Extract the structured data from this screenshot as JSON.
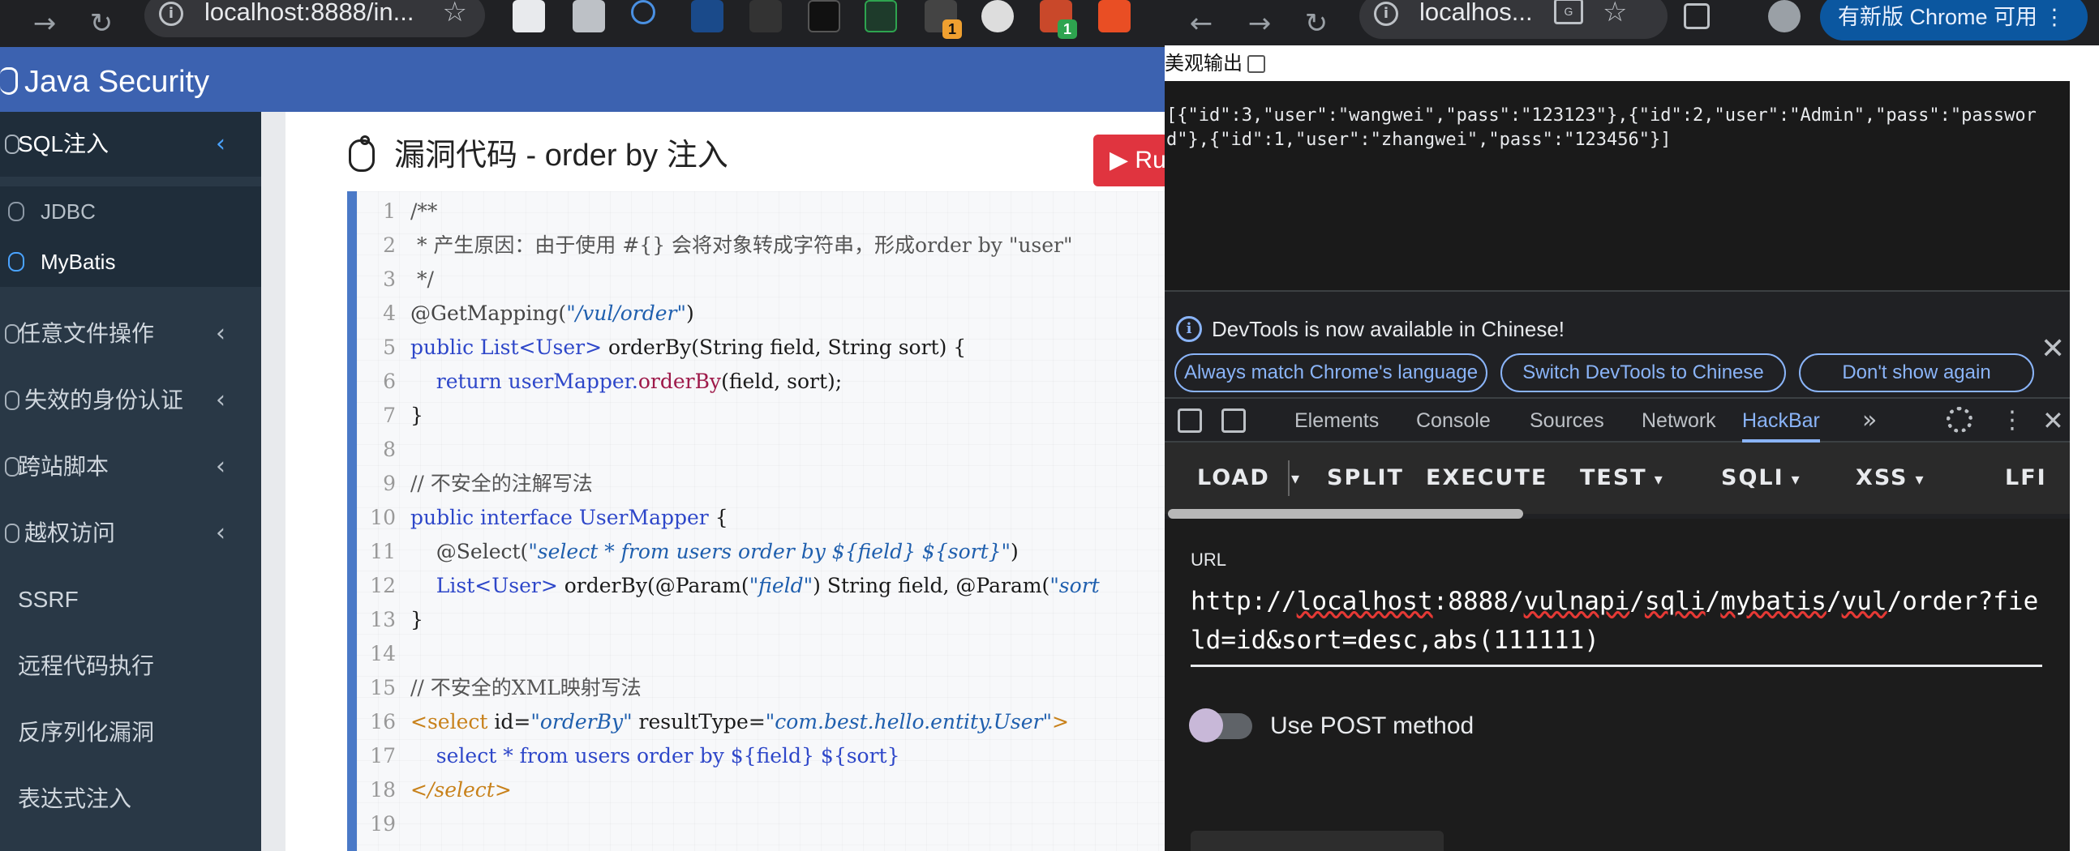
{
  "left_browser": {
    "url": "localhost:8888/in...",
    "app_title": "Java Security",
    "extension_badges": [
      "1",
      "1"
    ],
    "sidebar": {
      "items": [
        {
          "label": "SQL注入",
          "active": true
        },
        {
          "label": "任意文件操作"
        },
        {
          "label": "失效的身份认证"
        },
        {
          "label": "跨站脚本"
        },
        {
          "label": "越权访问"
        },
        {
          "label": "SSRF"
        },
        {
          "label": "远程代码执行"
        },
        {
          "label": "反序列化漏洞"
        },
        {
          "label": "表达式注入"
        }
      ],
      "subitems": [
        {
          "label": "JDBC"
        },
        {
          "label": "MyBatis",
          "selected": true
        }
      ]
    },
    "panel": {
      "title": "漏洞代码 - order by 注入",
      "run_label": "Ru"
    },
    "code": {
      "line_numbers": [
        "1",
        "2",
        "3",
        "4",
        "5",
        "6",
        "7",
        "8",
        "9",
        "10",
        "11",
        "12",
        "13",
        "14",
        "15",
        "16",
        "17",
        "18",
        "19"
      ],
      "lines": {
        "l1": "/**",
        "l2": " * 产生原因：由于使用 #{} 会将对象转成字符串，形成order by \"user\"",
        "l3": " */",
        "l4_a": "@GetMapping(",
        "l4_b": "\"/vul/order\"",
        "l4_c": ")",
        "l5_a": "public",
        "l5_b": " List<User>",
        "l5_c": " orderBy(String field, String sort) {",
        "l6_a": "    return userMapper.",
        "l6_b": "orderBy",
        "l6_c": "(field, sort);",
        "l7": "}",
        "l8": "",
        "l9": "// 不安全的注解写法",
        "l10_a": "public interface",
        "l10_b": " UserMapper",
        "l10_c": " {",
        "l11_a": "    @Select(",
        "l11_b": "\"select * from users order by ${field} ${sort}\"",
        "l11_c": ")",
        "l12_a": "    List<User>",
        "l12_b": " orderBy(@Param(",
        "l12_c": "\"field\"",
        "l12_d": ") String field, @Param(",
        "l12_e": "\"sort",
        "l13": "}",
        "l14": "",
        "l15": "// 不安全的XML映射写法",
        "l16_a": "<select",
        "l16_b": " id=",
        "l16_c": "\"orderBy\"",
        "l16_d": " resultType=",
        "l16_e": "\"com.best.hello.entity.User\"",
        "l16_f": ">",
        "l17": "    select * from users order by ${field} ${sort}",
        "l18": "</select>",
        "l19": ""
      }
    },
    "colors": {
      "header": "#3c62b0",
      "sidebar": "#293846",
      "run_button": "#e0343f"
    }
  },
  "right_browser": {
    "url": "localhos...",
    "update_button": "有新版 Chrome 可用",
    "pretty_print_label": "美观输出",
    "json_response": "[{\"id\":3,\"user\":\"wangwei\",\"pass\":\"123123\"},{\"id\":2,\"user\":\"Admin\",\"pass\":\"password\"},{\"id\":1,\"user\":\"zhangwei\",\"pass\":\"123456\"}]",
    "devtools_banner": {
      "message": "DevTools is now available in Chinese!",
      "buttons": [
        "Always match Chrome's language",
        "Switch DevTools to Chinese",
        "Don't show again"
      ]
    },
    "devtools_tabs": [
      "Elements",
      "Console",
      "Sources",
      "Network",
      "HackBar"
    ],
    "active_tab": "HackBar",
    "hackbar": {
      "toolbar": [
        "LOAD",
        "SPLIT",
        "EXECUTE",
        "TEST",
        "SQLI",
        "XSS",
        "LFI"
      ],
      "url_label": "URL",
      "url_value_parts": [
        "http://",
        "localhost",
        ":8888/",
        "vulnapi",
        "/",
        "sqli",
        "/",
        "mybatis",
        "/",
        "vul",
        "/order?field=id&sort=desc,abs(111111)"
      ],
      "post_toggle_label": "Use POST method",
      "post_enabled": false
    }
  }
}
